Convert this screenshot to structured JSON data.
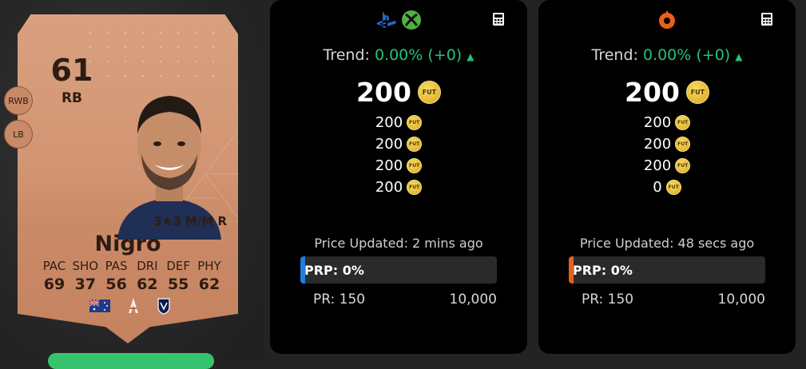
{
  "player": {
    "rating": "61",
    "position": "RB",
    "alt_positions": [
      "RWB",
      "LB"
    ],
    "playstyle": "3★3 M/M R",
    "name": "Nigro",
    "stat_labels": [
      "PAC",
      "SHO",
      "PAS",
      "DRI",
      "DEF",
      "PHY"
    ],
    "stat_values": [
      "69",
      "37",
      "56",
      "62",
      "55",
      "62"
    ],
    "badges": [
      "australia-flag",
      "a-league-logo",
      "melbourne-victory-crest"
    ]
  },
  "console_panel": {
    "platform_icons": [
      "playstation-icon",
      "xbox-icon"
    ],
    "trend_label": "Trend:",
    "trend_value": "0.00% (+0)",
    "main_price": "200",
    "sub_prices": [
      "200",
      "200",
      "200",
      "200"
    ],
    "updated": "Price Updated: 2 mins ago",
    "prp": "PRP: 0%",
    "pr_label": "PR: 150",
    "pr_max": "10,000",
    "accent": "#1e7fe0"
  },
  "pc_panel": {
    "platform_icons": [
      "origin-icon"
    ],
    "trend_label": "Trend:",
    "trend_value": "0.00% (+0)",
    "main_price": "200",
    "sub_prices": [
      "200",
      "200",
      "200",
      "0"
    ],
    "updated": "Price Updated: 48 secs ago",
    "prp": "PRP: 0%",
    "pr_label": "PR: 150",
    "pr_max": "10,000",
    "accent": "#e8601c"
  },
  "coin_label": "FUT"
}
